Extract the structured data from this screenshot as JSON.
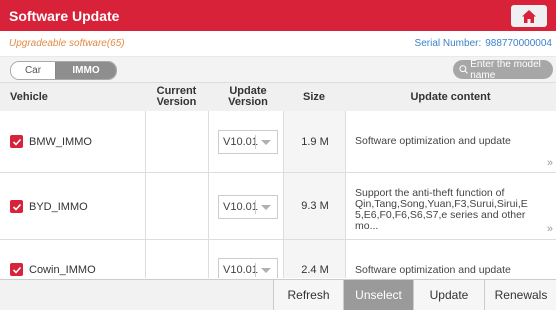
{
  "header": {
    "title": "Software Update",
    "home_icon": "home-icon",
    "bg_color": "#d7223a"
  },
  "info": {
    "upgradeable": "Upgradeable software(65)",
    "serial_label": "Serial Number:",
    "serial_value": "988770000004"
  },
  "filter": {
    "car_model": "Car model",
    "immo": "IMMO",
    "search_placeholder": "Enter the model name",
    "search_icon": "search-icon"
  },
  "table": {
    "headers": {
      "vehicle": "Vehicle",
      "current_version": "Current Version",
      "update_version": "Update Version",
      "size": "Size",
      "update_content": "Update content"
    },
    "rows": [
      {
        "vehicle": "BMW_IMMO",
        "checked": true,
        "current_version": "",
        "update_version": "V10.01",
        "size": "1.9 M",
        "content": "Software optimization and update",
        "more": "»"
      },
      {
        "vehicle": "BYD_IMMO",
        "checked": true,
        "current_version": "",
        "update_version": "V10.01",
        "size": "9.3 M",
        "content": "Support the anti-theft function of Qin,Tang,Song,Yuan,F3,Surui,Sirui,E 5,E6,F0,F6,S6,S7,e series and other mo...",
        "more": "»"
      },
      {
        "vehicle": "Cowin_IMMO",
        "checked": true,
        "current_version": "",
        "update_version": "V10.01",
        "size": "2.4 M",
        "content": "Software optimization and update",
        "more": ""
      }
    ]
  },
  "footer": {
    "refresh": "Refresh",
    "unselect": "Unselect",
    "update": "Update",
    "renewals": "Renewals"
  }
}
